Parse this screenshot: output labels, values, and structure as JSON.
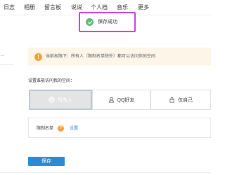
{
  "nav": {
    "items": [
      "日志",
      "相册",
      "留言板",
      "说说",
      "个人档",
      "音乐",
      "更多"
    ]
  },
  "toast": {
    "text": "保存成功"
  },
  "left_stub": {
    "text": "…"
  },
  "notice": {
    "text": "当前权限下：所有人（限制名单除外）都可以访问你的空间"
  },
  "access": {
    "label": "设置谁能访问我的空间：",
    "options": [
      {
        "label": "所有人",
        "icon": "globe-icon",
        "selected": true
      },
      {
        "label": "QQ好友",
        "icon": "friends-icon",
        "selected": false
      },
      {
        "label": "仅自己",
        "icon": "lock-icon",
        "selected": false
      }
    ]
  },
  "blacklist": {
    "label": "限制名单",
    "help": "?",
    "link": "设置"
  },
  "save_label": "保存",
  "colors": {
    "accent": "#2b8ad8",
    "toast_border": "#c93ad6",
    "success": "#5fb878",
    "warning": "#f0a23a",
    "notice_bg": "#fdf5e8"
  }
}
